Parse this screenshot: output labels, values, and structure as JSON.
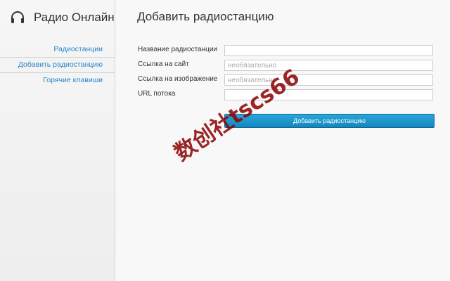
{
  "app": {
    "title": "Радио Онлайн",
    "icon": "headphones-icon"
  },
  "sidebar": {
    "items": [
      {
        "label": "Радиостанции",
        "active": false
      },
      {
        "label": "Добавить радиостанцию",
        "active": true
      },
      {
        "label": "Горячие клавиши",
        "active": false
      }
    ]
  },
  "main": {
    "title": "Добавить радиостанцию",
    "form": {
      "fields": [
        {
          "label": "Название радиостанции",
          "value": "",
          "placeholder": ""
        },
        {
          "label": "Ссылка на сайт",
          "value": "",
          "placeholder": "необязательно"
        },
        {
          "label": "Ссылка на изображение",
          "value": "",
          "placeholder": "необязательно"
        },
        {
          "label": "URL потока",
          "value": "",
          "placeholder": ""
        }
      ],
      "submit_label": "Добавить радиостанцию"
    }
  },
  "watermark": "数创社tscs66",
  "colors": {
    "accent": "#2a86c8",
    "button": "#1e97cc",
    "watermark": "#8b0000"
  }
}
